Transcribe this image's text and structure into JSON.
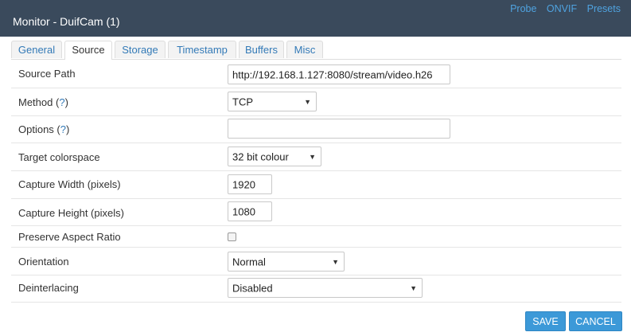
{
  "header": {
    "title": "Monitor - DuifCam (1)",
    "links": [
      "Probe",
      "ONVIF",
      "Presets"
    ]
  },
  "tabs": [
    {
      "label": "General"
    },
    {
      "label": "Source",
      "active": true
    },
    {
      "label": "Storage"
    },
    {
      "label": "Timestamp"
    },
    {
      "label": "Buffers"
    },
    {
      "label": "Misc"
    }
  ],
  "form": {
    "help_glyph": "?",
    "source_path": {
      "label": "Source Path",
      "value": "http://192.168.1.127:8080/stream/video.h26"
    },
    "method": {
      "label": "Method",
      "value": "TCP"
    },
    "options": {
      "label": "Options",
      "value": ""
    },
    "target_colorspace": {
      "label": "Target colorspace",
      "value": "32 bit colour"
    },
    "capture_width": {
      "label": "Capture Width (pixels)",
      "value": "1920"
    },
    "capture_height": {
      "label": "Capture Height (pixels)",
      "value": "1080"
    },
    "preserve_aspect_ratio": {
      "label": "Preserve Aspect Ratio",
      "checked": false
    },
    "orientation": {
      "label": "Orientation",
      "value": "Normal"
    },
    "deinterlacing": {
      "label": "Deinterlacing",
      "value": "Disabled"
    }
  },
  "actions": {
    "save_label": "SAVE",
    "cancel_label": "CANCEL"
  },
  "colors": {
    "header_bg": "#3a4a5c",
    "link": "#337ab7",
    "button_bg": "#3c99d8"
  },
  "icons": {
    "select_arrow": "▼"
  }
}
